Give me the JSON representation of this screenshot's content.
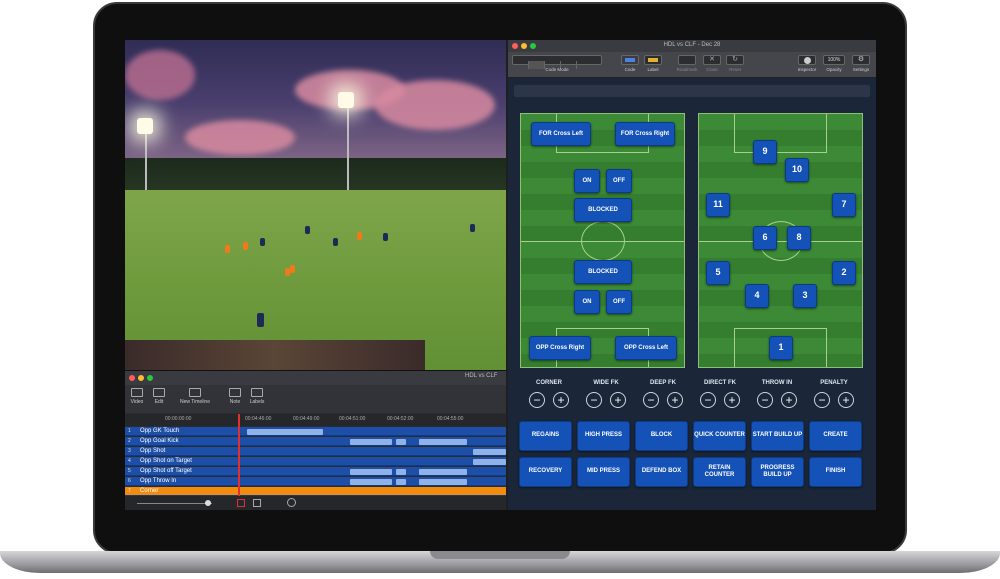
{
  "timeline": {
    "title": "HDL vs CLF",
    "tools": [
      "Video",
      "Edit",
      "New Timeline",
      "Note",
      "Labels"
    ],
    "timecodes": [
      "00:00:00:00",
      "00:04:46:00",
      "00:04:49:00",
      "00:04:51:00",
      "00:04:52:00",
      "00:04:55:00"
    ],
    "rows": [
      {
        "num": "1",
        "label": "Opp GK Touch"
      },
      {
        "num": "2",
        "label": "Opp Goal Kick"
      },
      {
        "num": "3",
        "label": "Opp Shot"
      },
      {
        "num": "4",
        "label": "Opp Shot on Target"
      },
      {
        "num": "5",
        "label": "Opp Shot off Target"
      },
      {
        "num": "6",
        "label": "Opp Throw In"
      },
      {
        "num": "7",
        "label": "Corner"
      }
    ]
  },
  "coding_app": {
    "title": "HDL vs CLF - Dec 28",
    "toolbar": {
      "code_mode": "Code Mode",
      "code": "Code",
      "label": "Label",
      "roadmark": "Roadmark",
      "close": "Close",
      "reset": "Reset",
      "inspector": "Inspector",
      "opacity_value": "100%",
      "opacity": "Opacity",
      "settings": "Settings"
    },
    "left_pitch": {
      "for_cross_left": "FOR Cross Left",
      "for_cross_right": "FOR Cross Right",
      "on_top": "ON",
      "off_top": "OFF",
      "blocked_top": "BLOCKED",
      "blocked_bottom": "BLOCKED",
      "on_bottom": "ON",
      "off_bottom": "OFF",
      "opp_cross_right": "OPP Cross Right",
      "opp_cross_left": "OPP Cross Left"
    },
    "right_pitch": {
      "players": [
        "9",
        "10",
        "11",
        "7",
        "6",
        "8",
        "5",
        "2",
        "4",
        "3",
        "1"
      ]
    },
    "categories": [
      "CORNER",
      "WIDE FK",
      "DEEP FK",
      "DIRECT FK",
      "THROW IN",
      "PENALTY"
    ],
    "minus": "−",
    "plus": "+",
    "actions_row1": [
      "REGAINS",
      "HIGH PRESS",
      "BLOCK",
      "QUICK COUNTER",
      "START BUILD UP",
      "CREATE"
    ],
    "actions_row2": [
      "RECOVERY",
      "MID PRESS",
      "DEFEND BOX",
      "RETAIN COUNTER",
      "PROGRESS BUILD UP",
      "FINISH"
    ]
  },
  "colors": {
    "button_blue": "#1552b8",
    "timeline_blue": "#1d4fa8",
    "timeline_orange": "#f28c0f",
    "close_dot": "#ff5f57",
    "min_dot": "#febc2e",
    "max_dot": "#28c840"
  }
}
